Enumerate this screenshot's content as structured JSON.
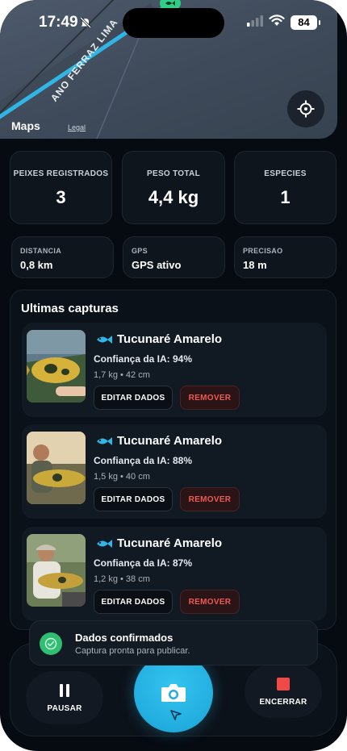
{
  "status_bar": {
    "time": "17:49",
    "battery": "84"
  },
  "map": {
    "street": "ANO FERRAZ LIMA",
    "brand": "Maps",
    "legal": "Legal"
  },
  "stats": [
    {
      "label": "PEIXES REGISTRADOS",
      "value": "3"
    },
    {
      "label": "PESO TOTAL",
      "value": "4,4 kg"
    },
    {
      "label": "ESPECIES",
      "value": "1"
    }
  ],
  "info": [
    {
      "label": "DISTANCIA",
      "value": "0,8 km"
    },
    {
      "label": "GPS",
      "value": "GPS ativo"
    },
    {
      "label": "PRECISAO",
      "value": "18 m"
    }
  ],
  "captures": {
    "title": "Ultimas capturas",
    "items": [
      {
        "name": "Tucunaré Amarelo",
        "confidence": "Confiança da IA: 94%",
        "meta": "1,7 kg • 42 cm",
        "edit": "EDITAR DADOS",
        "remove": "REMOVER"
      },
      {
        "name": "Tucunaré Amarelo",
        "confidence": "Confiança da IA: 88%",
        "meta": "1,5 kg • 40 cm",
        "edit": "EDITAR DADOS",
        "remove": "REMOVER"
      },
      {
        "name": "Tucunaré Amarelo",
        "confidence": "Confiança da IA: 87%",
        "meta": "1,2 kg • 38 cm",
        "edit": "EDITAR DADOS",
        "remove": "REMOVER"
      }
    ]
  },
  "toast": {
    "title": "Dados confirmados",
    "subtitle": "Captura pronta para publicar."
  },
  "controls": {
    "pause": "PAUSAR",
    "end": "ENCERRAR"
  },
  "colors": {
    "accent": "#22addf",
    "success": "#2fbf71",
    "danger": "#ef5a55",
    "background": "#060b12"
  }
}
